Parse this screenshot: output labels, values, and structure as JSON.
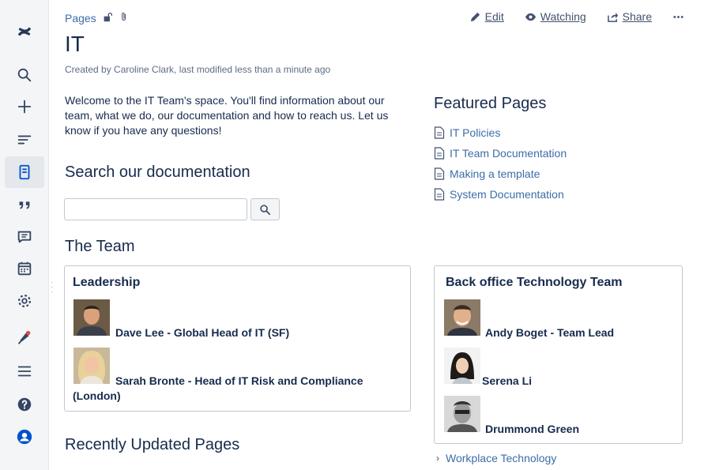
{
  "breadcrumb": {
    "pages_label": "Pages",
    "restrict_icon": "unlock-icon",
    "attachments_icon": "paperclip-icon"
  },
  "header_actions": {
    "edit": "Edit",
    "watching": "Watching",
    "share": "Share",
    "more_icon": "more-icon"
  },
  "page": {
    "title": "IT",
    "byline": "Created by Caroline Clark, last modified less than a minute ago",
    "welcome": "Welcome to the IT Team's space. You'll find information about our team, what we do, our documentation and how to reach us. Let us know if you have any questions!",
    "search_heading": "Search our documentation",
    "search_placeholder": "",
    "team_heading": "The Team",
    "recent_heading": "Recently Updated Pages",
    "featured_heading": "Featured Pages"
  },
  "featured_pages": [
    "IT Policies",
    "IT Team Documentation",
    "Making a template",
    "System Documentation"
  ],
  "leadership": {
    "title": "Leadership",
    "members": [
      "Dave Lee - Global Head of IT (SF)",
      "Sarah Bronte - Head of IT Risk and Compliance (London)"
    ]
  },
  "backoffice": {
    "title": "Back office Technology Team",
    "members": [
      "Andy Boget - Team Lead",
      "Serena Li",
      "Drummond Green"
    ]
  },
  "page_tree": {
    "item": "Workplace Technology"
  },
  "sidebar_icons": [
    "confluence-logo-icon",
    "search-icon",
    "create-icon",
    "recent-icon",
    "pages-icon",
    "blog-icon",
    "comments-icon",
    "calendar-icon",
    "settings-icon",
    "notifications-icon",
    "menu-icon",
    "help-icon",
    "profile-icon"
  ],
  "colors": {
    "link": "#3b6ea8",
    "sidebar_bg": "#f4f5f7",
    "notification_dot": "#e5493a"
  }
}
